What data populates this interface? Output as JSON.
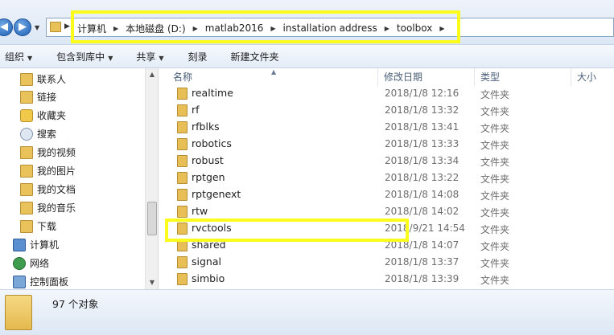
{
  "address": {
    "crumbs": [
      "计算机",
      "本地磁盘 (D:)",
      "matlab2016",
      "installation address",
      "toolbox"
    ]
  },
  "toolbar": {
    "organize": "组织",
    "include_in_library": "包含到库中",
    "share": "共享",
    "burn": "刻录",
    "new_folder": "新建文件夹"
  },
  "sidebar": {
    "items": [
      {
        "label": "联系人",
        "icon": "contacts-folder-icon"
      },
      {
        "label": "链接",
        "icon": "links-folder-icon"
      },
      {
        "label": "收藏夹",
        "icon": "favorites-star-icon"
      },
      {
        "label": "搜索",
        "icon": "searches-icon"
      },
      {
        "label": "我的视频",
        "icon": "videos-folder-icon"
      },
      {
        "label": "我的图片",
        "icon": "pictures-folder-icon"
      },
      {
        "label": "我的文档",
        "icon": "documents-folder-icon"
      },
      {
        "label": "我的音乐",
        "icon": "music-folder-icon"
      },
      {
        "label": "下载",
        "icon": "downloads-folder-icon"
      },
      {
        "label": "计算机",
        "icon": "computer-icon"
      },
      {
        "label": "网络",
        "icon": "network-icon"
      },
      {
        "label": "控制面板",
        "icon": "control-panel-icon"
      }
    ]
  },
  "columns": {
    "name": "名称",
    "modified": "修改日期",
    "type": "类型",
    "size": "大小"
  },
  "files": [
    {
      "name": "realtime",
      "date": "2018/1/8 12:16",
      "type": "文件夹"
    },
    {
      "name": "rf",
      "date": "2018/1/8 13:32",
      "type": "文件夹"
    },
    {
      "name": "rfblks",
      "date": "2018/1/8 13:41",
      "type": "文件夹"
    },
    {
      "name": "robotics",
      "date": "2018/1/8 13:33",
      "type": "文件夹"
    },
    {
      "name": "robust",
      "date": "2018/1/8 13:34",
      "type": "文件夹"
    },
    {
      "name": "rptgen",
      "date": "2018/1/8 13:22",
      "type": "文件夹"
    },
    {
      "name": "rptgenext",
      "date": "2018/1/8 14:08",
      "type": "文件夹"
    },
    {
      "name": "rtw",
      "date": "2018/1/8 14:02",
      "type": "文件夹"
    },
    {
      "name": "rvctools",
      "date": "2018/9/21 14:54",
      "type": "文件夹"
    },
    {
      "name": "shared",
      "date": "2018/1/8 14:07",
      "type": "文件夹"
    },
    {
      "name": "signal",
      "date": "2018/1/8 13:37",
      "type": "文件夹"
    },
    {
      "name": "simbio",
      "date": "2018/1/8 13:39",
      "type": "文件夹"
    }
  ],
  "status": {
    "count_text": "97 个对象"
  },
  "colors": {
    "highlight": "#fbfb1c",
    "folder": "#e7bf56"
  }
}
